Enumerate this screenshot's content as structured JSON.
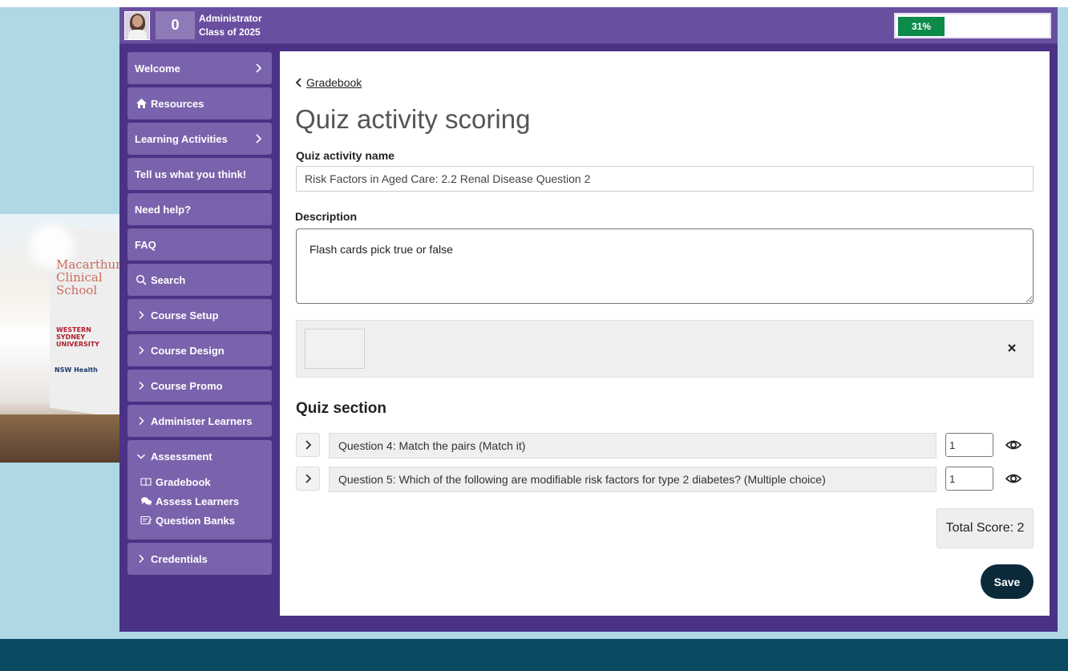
{
  "header": {
    "points": "0",
    "role": "Administrator",
    "cohort": "Class of 2025",
    "progress_label": "31%",
    "progress_value": 0.31
  },
  "sidebar": {
    "items": [
      {
        "label": "Welcome",
        "icon": "chevron-right-icon"
      },
      {
        "label": "Resources",
        "icon": "home-icon"
      },
      {
        "label": "Learning Activities",
        "icon": "chevron-right-icon"
      },
      {
        "label": "Tell us what you think!"
      },
      {
        "label": "Need help?"
      },
      {
        "label": "FAQ"
      },
      {
        "label": "Search",
        "icon": "search-icon"
      },
      {
        "label": "Course Setup",
        "icon": "chevron-right-icon"
      },
      {
        "label": "Course Design",
        "icon": "chevron-right-icon"
      },
      {
        "label": "Course Promo",
        "icon": "chevron-right-icon"
      },
      {
        "label": "Administer Learners",
        "icon": "chevron-right-icon"
      }
    ],
    "assessment": {
      "label": "Assessment",
      "children": [
        {
          "label": "Gradebook",
          "icon": "book-icon"
        },
        {
          "label": "Assess Learners",
          "icon": "chat-icon"
        },
        {
          "label": "Question Banks",
          "icon": "edit-icon"
        }
      ]
    },
    "credentials": {
      "label": "Credentials"
    }
  },
  "main": {
    "breadcrumb": "Gradebook",
    "title": "Quiz activity scoring",
    "name_label": "Quiz activity name",
    "name_value": "Risk Factors in Aged Care: 2.2 Renal Disease Question 2",
    "description_label": "Description",
    "description_value": "Flash cards pick true or false",
    "section_title": "Quiz section",
    "questions": [
      {
        "title": "Question 4: Match the pairs (Match it)",
        "score": "1"
      },
      {
        "title": "Question 5: Which of the following are modifiable risk factors for type 2 diabetes? (Multiple choice)",
        "score": "1"
      }
    ],
    "total_score": "Total Score: 2",
    "save_label": "Save"
  },
  "background": {
    "sign_line1": "Macarthur",
    "sign_line2": "Clinical School",
    "sign_logo1": "WESTERN SYDNEY UNIVERSITY",
    "sign_logo2": "NSW Health"
  }
}
